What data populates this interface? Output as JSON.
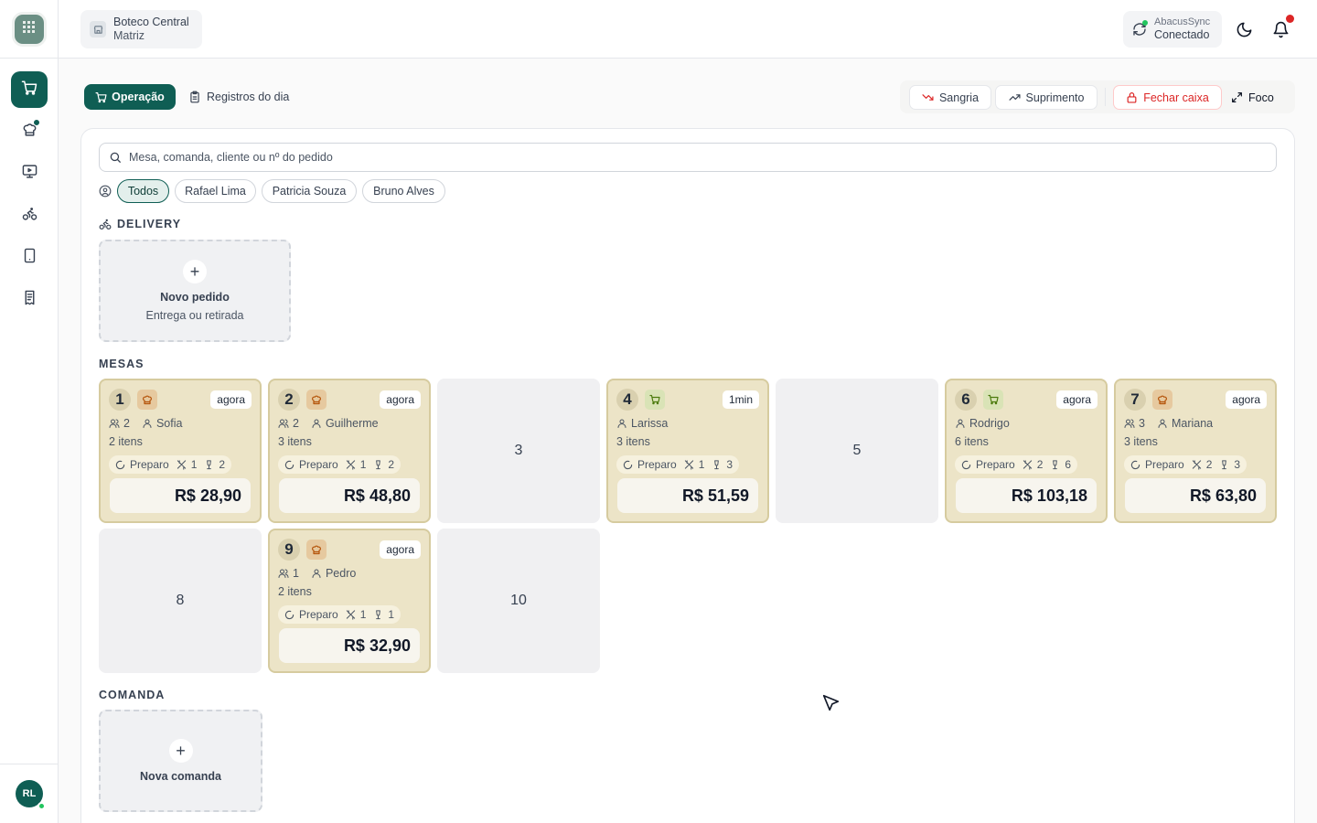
{
  "rail": {
    "logo_icon": "grid-icon",
    "items": [
      {
        "name": "cart-icon",
        "active": true
      },
      {
        "name": "chef-hat-icon",
        "badge": true
      },
      {
        "name": "monitor-icon"
      },
      {
        "name": "bike-icon"
      },
      {
        "name": "tablet-icon"
      },
      {
        "name": "receipt-icon"
      }
    ],
    "user_initials": "RL"
  },
  "topbar": {
    "store_name": "Boteco Central",
    "store_branch": "Matriz",
    "sync_name": "AbacusSync",
    "sync_status": "Conectado"
  },
  "toolbar": {
    "tab_operacao": "Operação",
    "tab_registros": "Registros do dia",
    "sangria": "Sangria",
    "suprimento": "Suprimento",
    "fechar_caixa": "Fechar caixa",
    "foco": "Foco"
  },
  "search": {
    "placeholder": "Mesa, comanda, cliente ou nº do pedido"
  },
  "filters": [
    "Todos",
    "Rafael Lima",
    "Patricia Souza",
    "Bruno Alves"
  ],
  "delivery": {
    "label": "DELIVERY",
    "new_title": "Novo pedido",
    "new_sub": "Entrega ou retirada"
  },
  "mesas": {
    "label": "MESAS",
    "tables": [
      {
        "number": "1",
        "status": "occupied",
        "icon": "chef-hat-icon",
        "time": "agora",
        "guests": "2",
        "customer": "Sofia",
        "items": "2 itens",
        "prep_label": "Preparo",
        "kitchen": "1",
        "bar": "2",
        "total": "R$ 28,90"
      },
      {
        "number": "2",
        "status": "occupied",
        "icon": "chef-hat-icon",
        "time": "agora",
        "guests": "2",
        "customer": "Guilherme",
        "items": "3 itens",
        "prep_label": "Preparo",
        "kitchen": "1",
        "bar": "2",
        "total": "R$ 48,80"
      },
      {
        "number": "3",
        "status": "free"
      },
      {
        "number": "4",
        "status": "occupied",
        "icon": "cart-icon",
        "time": "1min",
        "guests": "",
        "customer": "Larissa",
        "items": "3 itens",
        "prep_label": "Preparo",
        "kitchen": "1",
        "bar": "3",
        "total": "R$ 51,59"
      },
      {
        "number": "5",
        "status": "free"
      },
      {
        "number": "6",
        "status": "occupied",
        "icon": "cart-icon",
        "time": "agora",
        "guests": "",
        "customer": "Rodrigo",
        "items": "6 itens",
        "prep_label": "Preparo",
        "kitchen": "2",
        "bar": "6",
        "total": "R$ 103,18"
      },
      {
        "number": "7",
        "status": "occupied",
        "icon": "chef-hat-icon",
        "time": "agora",
        "guests": "3",
        "customer": "Mariana",
        "items": "3 itens",
        "prep_label": "Preparo",
        "kitchen": "2",
        "bar": "3",
        "total": "R$ 63,80"
      },
      {
        "number": "8",
        "status": "free"
      },
      {
        "number": "9",
        "status": "occupied",
        "icon": "chef-hat-icon",
        "time": "agora",
        "guests": "1",
        "customer": "Pedro",
        "items": "2 itens",
        "prep_label": "Preparo",
        "kitchen": "1",
        "bar": "1",
        "total": "R$ 32,90"
      },
      {
        "number": "10",
        "status": "free"
      }
    ]
  },
  "comanda": {
    "label": "COMANDA",
    "new_title": "Nova comanda"
  },
  "colors": {
    "primary": "#0f5e54",
    "occupied_bg": "#ece4c7",
    "free_bg": "#f0f0f2",
    "danger": "#dc2626"
  }
}
